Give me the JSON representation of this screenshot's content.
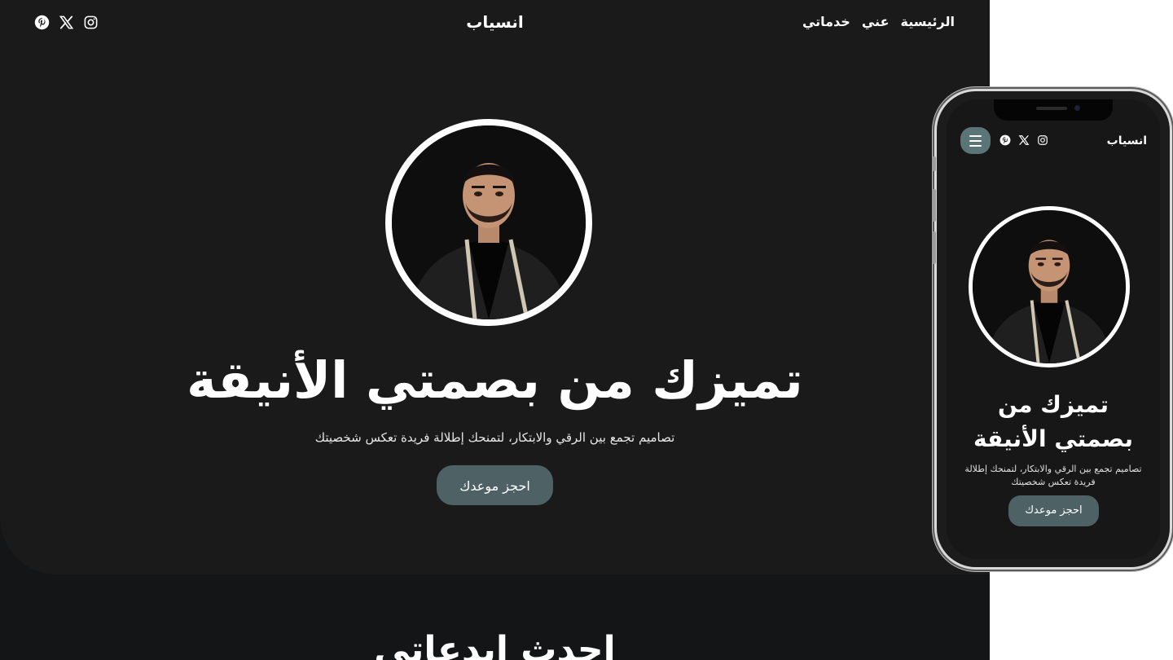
{
  "nav": {
    "links": [
      "الرئيسية",
      "عني",
      "خدماتي"
    ],
    "brand": "انسياب",
    "socials": [
      "pinterest-icon",
      "x-icon",
      "instagram-icon"
    ]
  },
  "hero": {
    "title": "تميزك من بصمتي الأنيقة",
    "subtitle": "تصاميم تجمع بين الرقي والابتكار، لتمنحك إطلالة فريدة تعكس شخصيتك",
    "cta": "احجز موعدك"
  },
  "next_section": {
    "title": "احدث ابدعاتي"
  },
  "mobile": {
    "brand": "انسياب",
    "title": "تميزك من بصمتي الأنيقة",
    "subtitle": "تصاميم تجمع بين الرقي والابتكار، لتمنحك إطلالة فريدة تعكس شخصيتك",
    "cta": "احجز موعدك"
  },
  "colors": {
    "background": "#1a1a1a",
    "accent_button": "#4e6266",
    "menu_button": "#5b7478",
    "text": "#ffffff"
  }
}
